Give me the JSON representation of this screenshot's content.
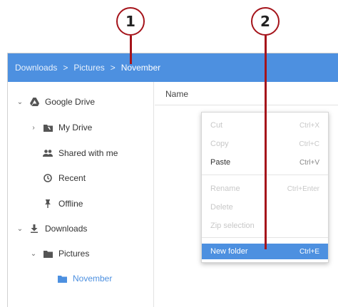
{
  "callouts": [
    "1",
    "2"
  ],
  "breadcrumb": {
    "items": [
      "Downloads",
      "Pictures",
      "November"
    ],
    "separator": ">"
  },
  "sidebar": {
    "items": [
      {
        "label": "Google Drive",
        "icon": "google-drive-icon",
        "chevron": "expanded"
      },
      {
        "label": "My Drive",
        "icon": "folder-drive-icon",
        "chevron": "collapsed"
      },
      {
        "label": "Shared with me",
        "icon": "people-icon"
      },
      {
        "label": "Recent",
        "icon": "clock-icon"
      },
      {
        "label": "Offline",
        "icon": "pin-icon"
      },
      {
        "label": "Downloads",
        "icon": "download-icon",
        "chevron": "expanded"
      },
      {
        "label": "Pictures",
        "icon": "folder-icon",
        "chevron": "expanded"
      },
      {
        "label": "November",
        "icon": "folder-icon",
        "selected": true
      }
    ]
  },
  "main": {
    "column_header": "Name"
  },
  "context_menu": {
    "items": [
      {
        "label": "Cut",
        "shortcut": "Ctrl+X",
        "enabled": false
      },
      {
        "label": "Copy",
        "shortcut": "Ctrl+C",
        "enabled": false
      },
      {
        "label": "Paste",
        "shortcut": "Ctrl+V",
        "enabled": true
      },
      {
        "label": "Rename",
        "shortcut": "Ctrl+Enter",
        "enabled": false
      },
      {
        "label": "Delete",
        "shortcut": "",
        "enabled": false
      },
      {
        "label": "Zip selection",
        "shortcut": "",
        "enabled": false
      },
      {
        "label": "New folder",
        "shortcut": "Ctrl+E",
        "enabled": true,
        "highlighted": true
      }
    ]
  },
  "colors": {
    "accent": "#4d90e0",
    "callout": "#a5141b"
  }
}
